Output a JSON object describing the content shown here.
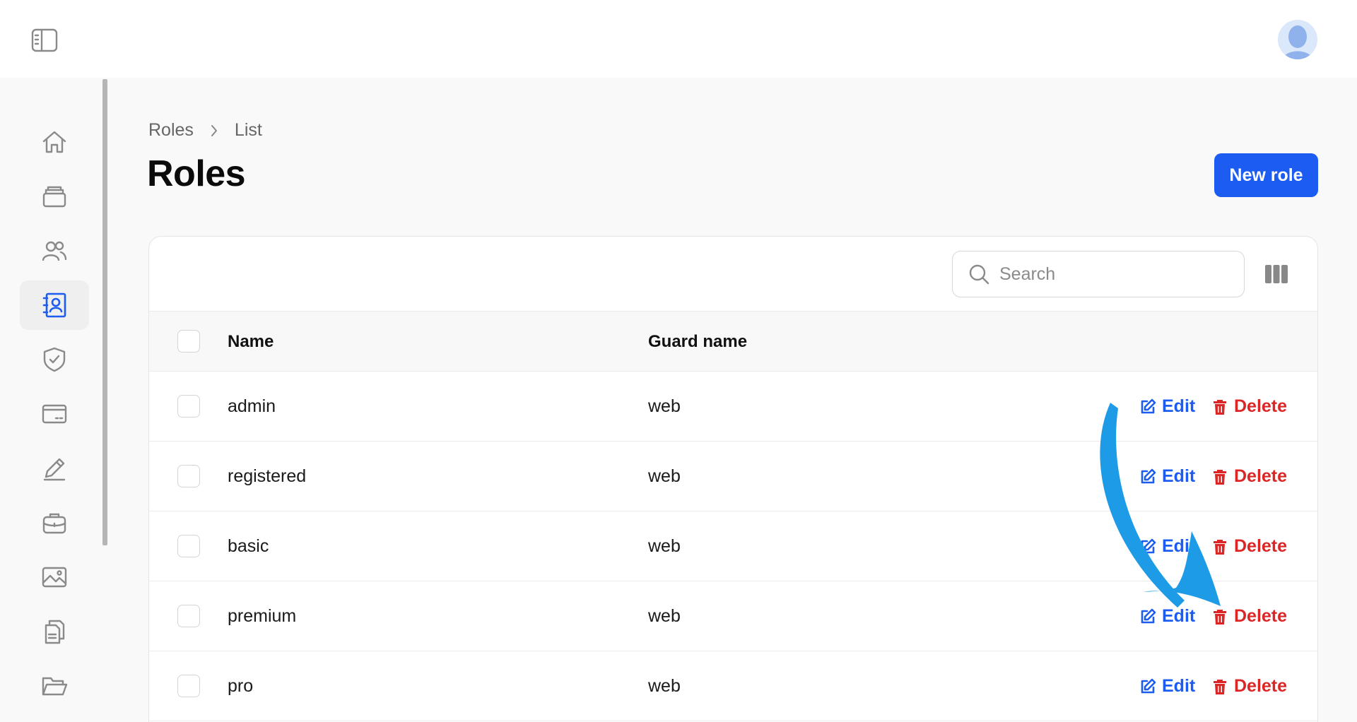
{
  "colors": {
    "accent": "#1c5cf0",
    "danger": "#dc2626",
    "annotation_arrow": "#1e9be6"
  },
  "topbar": {
    "toggle_icon": "sidebar-toggle-icon",
    "avatar_icon": "user-avatar"
  },
  "sidebar": {
    "items": [
      {
        "icon": "home-icon"
      },
      {
        "icon": "archive-box-icon"
      },
      {
        "icon": "users-icon"
      },
      {
        "icon": "contact-book-icon",
        "active": true
      },
      {
        "icon": "shield-check-icon"
      },
      {
        "icon": "credit-card-icon"
      },
      {
        "icon": "pencil-icon"
      },
      {
        "icon": "briefcase-icon"
      },
      {
        "icon": "image-icon"
      },
      {
        "icon": "documents-icon"
      },
      {
        "icon": "folder-open-icon"
      }
    ]
  },
  "breadcrumb": {
    "items": [
      "Roles",
      "List"
    ]
  },
  "page": {
    "title": "Roles",
    "new_button": "New role"
  },
  "search": {
    "placeholder": "Search",
    "value": ""
  },
  "table": {
    "columns": [
      "Name",
      "Guard name"
    ],
    "rows": [
      {
        "name": "admin",
        "guard": "web"
      },
      {
        "name": "registered",
        "guard": "web"
      },
      {
        "name": "basic",
        "guard": "web"
      },
      {
        "name": "premium",
        "guard": "web"
      },
      {
        "name": "pro",
        "guard": "web"
      }
    ],
    "actions": {
      "edit": "Edit",
      "delete": "Delete"
    }
  }
}
